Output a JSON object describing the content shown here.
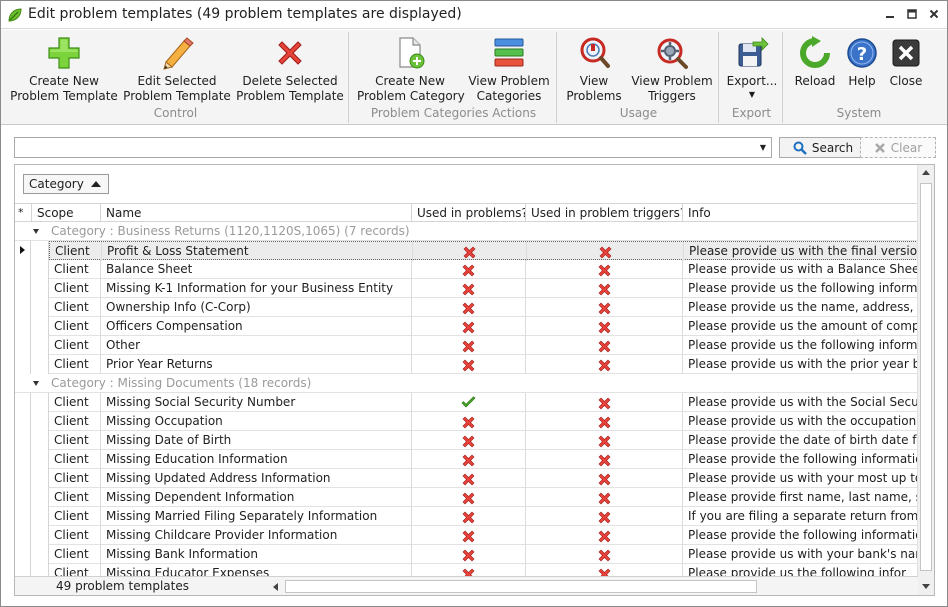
{
  "window": {
    "title": "Edit problem templates (49 problem templates are displayed)",
    "controls": [
      "minimize",
      "maximize",
      "close"
    ]
  },
  "ribbon": {
    "groups": [
      {
        "label": "Control",
        "buttons": [
          {
            "line1": "Create New",
            "line2": "Problem Template",
            "icon": "plus-icon"
          },
          {
            "line1": "Edit Selected",
            "line2": "Problem Template",
            "icon": "pencil-icon"
          },
          {
            "line1": "Delete Selected",
            "line2": "Problem Template",
            "icon": "delete-x-icon"
          }
        ]
      },
      {
        "label": "Problem Categories Actions",
        "buttons": [
          {
            "line1": "Create New",
            "line2": "Problem Category",
            "icon": "new-document-icon"
          },
          {
            "line1": "View Problem",
            "line2": "Categories",
            "icon": "categories-icon"
          }
        ]
      },
      {
        "label": "Usage",
        "buttons": [
          {
            "line1": "View",
            "line2": "Problems",
            "icon": "problems-magnifier-icon"
          },
          {
            "line1": "View Problem",
            "line2": "Triggers",
            "icon": "triggers-gear-icon"
          }
        ]
      },
      {
        "label": "Export",
        "buttons": [
          {
            "line1": "Export...",
            "line2": "",
            "icon": "export-floppy-icon"
          }
        ]
      },
      {
        "label": "System",
        "buttons": [
          {
            "line1": "Reload",
            "line2": "",
            "icon": "reload-icon"
          },
          {
            "line1": "Help",
            "line2": "",
            "icon": "help-icon"
          },
          {
            "line1": "Close",
            "line2": "",
            "icon": "close-icon"
          }
        ]
      }
    ]
  },
  "search": {
    "value": "",
    "search_label": "Search",
    "clear_label": "Clear"
  },
  "grid": {
    "group_by_chip": "Category",
    "columns": [
      "Scope",
      "Name",
      "Used in problems?",
      "Used in problem triggers?",
      "Info"
    ],
    "indicator_header": "*",
    "groups": [
      {
        "label": "Category : Business Returns (1120,1120S,1065) (7 records)",
        "rows": [
          {
            "scope": "Client",
            "name": "Profit & Loss Statement",
            "used_in_problems": false,
            "used_in_triggers": false,
            "info": "Please provide us with the final version of",
            "selected": true
          },
          {
            "scope": "Client",
            "name": "Balance Sheet",
            "used_in_problems": false,
            "used_in_triggers": false,
            "info": "Please provide us with a Balance Sheet at"
          },
          {
            "scope": "Client",
            "name": "Missing K-1 Information for your Business Entity",
            "used_in_problems": false,
            "used_in_triggers": false,
            "info": "Please provide us the following information w"
          },
          {
            "scope": "Client",
            "name": "Ownership Info (C-Corp)",
            "used_in_problems": false,
            "used_in_triggers": false,
            "info": "Please provide us the name, address, SS#"
          },
          {
            "scope": "Client",
            "name": "Officers Compensation",
            "used_in_problems": false,
            "used_in_triggers": false,
            "info": "Please provide us the amount of compens"
          },
          {
            "scope": "Client",
            "name": "Other",
            "used_in_problems": false,
            "used_in_triggers": false,
            "info": "Please provide us the following informatio"
          },
          {
            "scope": "Client",
            "name": "Prior Year Returns",
            "used_in_problems": false,
            "used_in_triggers": false,
            "info": "Please provide us with the prior year busi"
          }
        ]
      },
      {
        "label": "Category : Missing Documents (18 records)",
        "rows": [
          {
            "scope": "Client",
            "name": "Missing Social Security Number",
            "used_in_problems": true,
            "used_in_triggers": false,
            "info": "Please provide us with the Social Security"
          },
          {
            "scope": "Client",
            "name": "Missing Occupation",
            "used_in_problems": false,
            "used_in_triggers": false,
            "info": "Please provide us with the occupation for"
          },
          {
            "scope": "Client",
            "name": "Missing Date of Birth",
            "used_in_problems": false,
            "used_in_triggers": false,
            "info": "Please provide the date of birth date for:"
          },
          {
            "scope": "Client",
            "name": "Missing Education Information",
            "used_in_problems": false,
            "used_in_triggers": false,
            "info": "Please provide the following information:"
          },
          {
            "scope": "Client",
            "name": "Missing Updated Address Information",
            "used_in_problems": false,
            "used_in_triggers": false,
            "info": "Please provide us with your most up to d"
          },
          {
            "scope": "Client",
            "name": "Missing Dependent Information",
            "used_in_problems": false,
            "used_in_triggers": false,
            "info": "Please provide first name, last name, socia"
          },
          {
            "scope": "Client",
            "name": "Missing Married Filing Separately Information",
            "used_in_problems": false,
            "used_in_triggers": false,
            "info": "If you are filing a separate return from yo"
          },
          {
            "scope": "Client",
            "name": "Missing Childcare Provider Information",
            "used_in_problems": false,
            "used_in_triggers": false,
            "info": "Please provide the following information:"
          },
          {
            "scope": "Client",
            "name": "Missing Bank Information",
            "used_in_problems": false,
            "used_in_triggers": false,
            "info": "Please provide us with your bank's name,"
          },
          {
            "scope": "Client",
            "name": "Missing Educator Expenses",
            "used_in_problems": false,
            "used_in_triggers": false,
            "info": "Please provide us the following infor"
          }
        ]
      }
    ],
    "footer_count": "49 problem templates"
  },
  "colors": {
    "no": "#e8413b",
    "yes": "#4aa82b",
    "accent": "#1f6fc1"
  }
}
